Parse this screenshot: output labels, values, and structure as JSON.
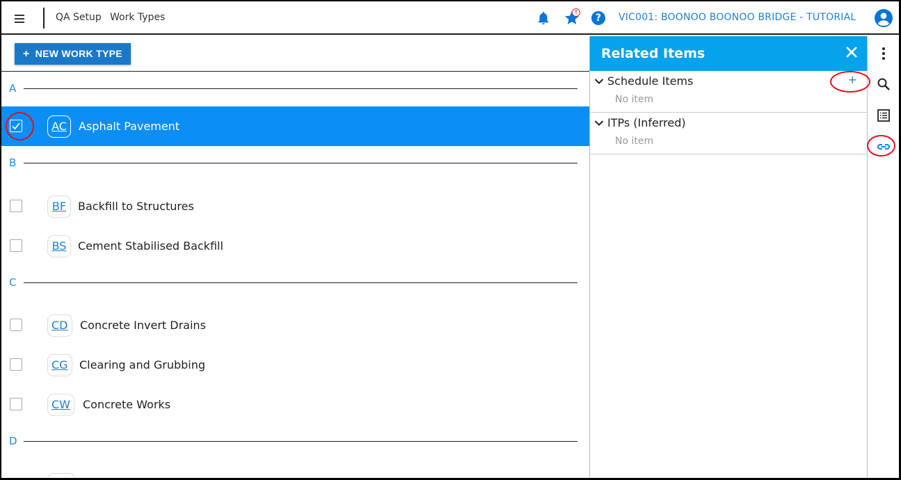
{
  "header": {
    "breadcrumb": [
      "QA Setup",
      "Work Types"
    ],
    "project": "VIC001: BOONOO BOONOO BRIDGE - TUTORIAL",
    "notification_badge": "!",
    "help_label": "?",
    "accent_color": "#1f7fd6"
  },
  "toolbar": {
    "new_button_label": "NEW WORK TYPE",
    "new_button_icon": "+"
  },
  "groups": [
    {
      "letter": "A",
      "items": [
        {
          "code": "AC",
          "name": "Asphalt Pavement",
          "selected": true
        }
      ]
    },
    {
      "letter": "B",
      "items": [
        {
          "code": "BF",
          "name": "Backfill to Structures",
          "selected": false
        },
        {
          "code": "BS",
          "name": "Cement Stabilised Backfill",
          "selected": false
        }
      ]
    },
    {
      "letter": "C",
      "items": [
        {
          "code": "CD",
          "name": "Concrete Invert Drains",
          "selected": false
        },
        {
          "code": "CG",
          "name": "Clearing and Grubbing",
          "selected": false
        },
        {
          "code": "CW",
          "name": "Concrete Works",
          "selected": false
        }
      ]
    },
    {
      "letter": "D",
      "items": []
    }
  ],
  "panel": {
    "title": "Related Items",
    "header_color": "#06a2ec",
    "sections": [
      {
        "title": "Schedule Items",
        "empty_text": "No item",
        "add_label": "+"
      },
      {
        "title": "ITPs (Inferred)",
        "empty_text": "No item"
      }
    ]
  },
  "rail": {
    "icons": [
      "more-vert-icon",
      "search-icon",
      "list-icon",
      "link-icon"
    ]
  }
}
